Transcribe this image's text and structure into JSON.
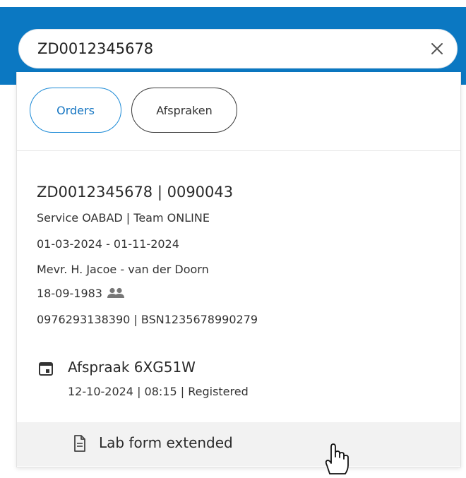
{
  "search": {
    "value": "ZD0012345678"
  },
  "icons": {
    "clear": "close-icon",
    "people": "people-icon",
    "calendar": "calendar-icon",
    "document": "document-icon",
    "cursor": "hand-pointer-cursor"
  },
  "tabs": [
    {
      "label": "Orders",
      "active": true
    },
    {
      "label": "Afspraken",
      "active": false
    }
  ],
  "result": {
    "id_line": "ZD0012345678 | 0090043",
    "service_line": "Service OABAD | Team ONLINE",
    "period": "01-03-2024 - 01-11-2024",
    "name": "Mevr. H. Jacoe - van der Doorn",
    "birthdate": "18-09-1983",
    "ids": "0976293138390 | BSN1235678990279"
  },
  "appointment": {
    "title": "Afspraak 6XG51W",
    "subtitle": "12-10-2024 | 08:15 | Registered"
  },
  "lab_form": {
    "label": "Lab form extended"
  },
  "colors": {
    "header": "#0b78c2",
    "active_tab": "#1c8ad6",
    "hover_row": "#f2f2f2"
  }
}
